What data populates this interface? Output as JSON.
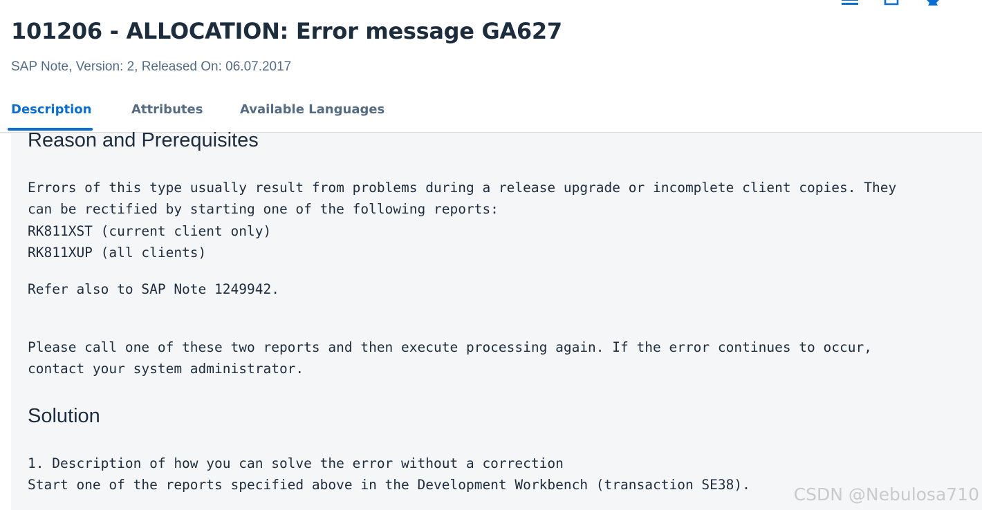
{
  "note": {
    "title": "101206 - ALLOCATION: Error message GA627",
    "subtitle": "SAP Note, Version: 2, Released On: 06.07.2017"
  },
  "tabs": [
    {
      "label": "Description",
      "active": true
    },
    {
      "label": "Attributes",
      "active": false
    },
    {
      "label": "Available Languages",
      "active": false
    }
  ],
  "sections": {
    "reason": {
      "heading": "Reason and Prerequisites",
      "para1_line1": "Errors of this type usually result from problems during a release upgrade or incomplete client copies. They",
      "para1_line2": "can be rectified by starting one of the following reports:",
      "report1": "RK811XST (current client only)",
      "report2": "RK811XUP (all clients)",
      "refer": "Refer also to SAP Note 1249942.",
      "para2_line1": "Please call one of these two reports and then execute processing again. If the error continues to occur,",
      "para2_line2": "contact your system administrator."
    },
    "solution": {
      "heading": "Solution",
      "line1": "1. Description of how you can solve the error without a correction",
      "line2": "Start one of the reports specified above in the Development Workbench (transaction SE38)."
    }
  },
  "icons": {
    "toolbar": [
      "menu-icon",
      "bookmark-icon",
      "star-icon"
    ],
    "accent_color": "#0a6ed1"
  },
  "watermark": "CSDN @Nebulosa710"
}
